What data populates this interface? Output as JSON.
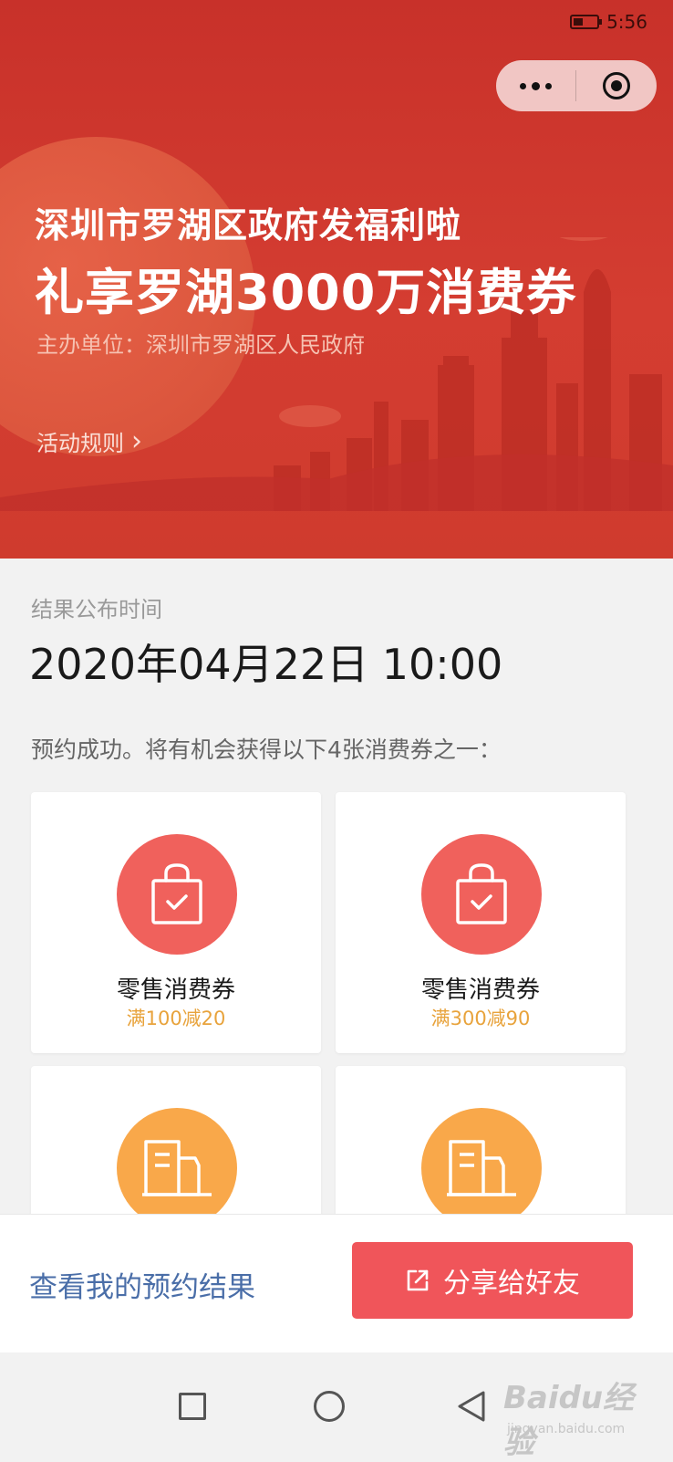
{
  "status_bar": {
    "time": "5:56"
  },
  "banner": {
    "title_line1": "深圳市罗湖区政府发福利啦",
    "title_line2": "礼享罗湖3000万消费券",
    "organizer": "主办单位：深圳市罗湖区人民政府",
    "rules_link": "活动规则",
    "chevron": "›"
  },
  "result": {
    "label": "结果公布时间",
    "datetime": "2020年04月22日 10:00"
  },
  "notice": "预约成功。将有机会获得以下4张消费券之一：",
  "coupons": [
    {
      "name": "零售消费券",
      "desc": "满100减20",
      "icon": "shopping-bag-icon",
      "color": "#f0615c"
    },
    {
      "name": "零售消费券",
      "desc": "满300减90",
      "icon": "shopping-bag-icon",
      "color": "#f0615c"
    },
    {
      "name": "",
      "desc": "",
      "icon": "building-icon",
      "color": "#f9a84a"
    },
    {
      "name": "",
      "desc": "",
      "icon": "building-icon",
      "color": "#f9a84a"
    }
  ],
  "bottom": {
    "my_result": "查看我的预约结果",
    "share": "分享给好友"
  },
  "watermark": {
    "main": "Baidu经验",
    "sub": "jingyan.baidu.com"
  },
  "colors": {
    "banner_red": "#c8312a",
    "accent_red": "#f0555a",
    "coupon_orange": "#f9a84a",
    "link_blue": "#4a6ea8"
  }
}
